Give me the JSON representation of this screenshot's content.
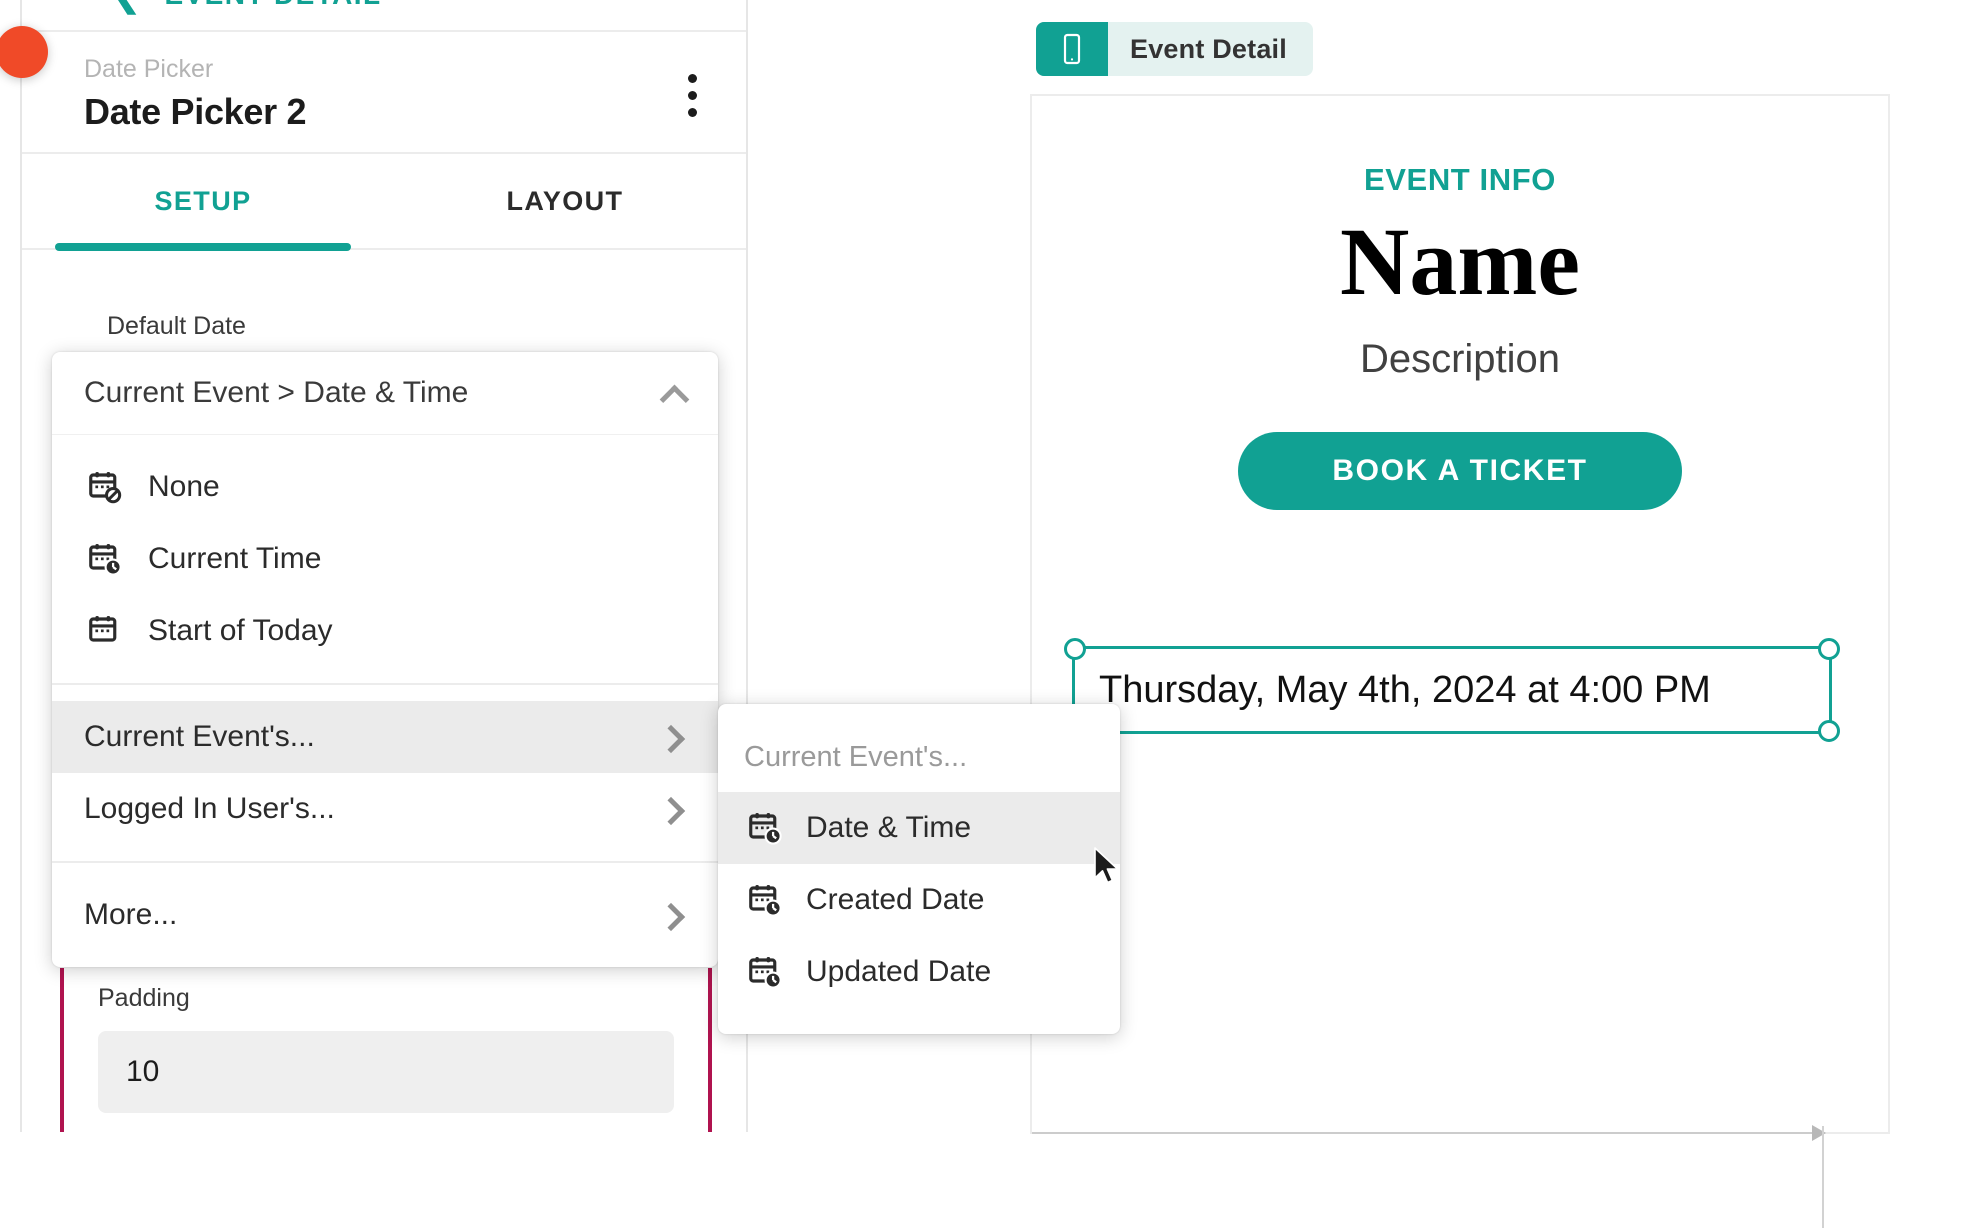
{
  "inspector": {
    "breadcrumb": {
      "label": "EVENT DETAIL",
      "chevron_icon": "chevron-left-icon"
    },
    "element": {
      "kind": "Date Picker",
      "name": "Date Picker 2",
      "menu_icon": "kebab-menu-icon"
    },
    "tabs": [
      {
        "label": "SETUP",
        "active": true
      },
      {
        "label": "LAYOUT",
        "active": false
      }
    ],
    "fields": {
      "default_date_label": "Default Date",
      "padding_label": "Padding",
      "padding_value": "10"
    }
  },
  "dropdown": {
    "header_value": "Current Event > Date & Time",
    "collapse_icon": "chevron-up-icon",
    "options": [
      {
        "label": "None",
        "icon": "calendar-none-icon"
      },
      {
        "label": "Current Time",
        "icon": "calendar-clock-icon"
      },
      {
        "label": "Start of Today",
        "icon": "calendar-icon"
      }
    ],
    "groups": [
      {
        "label": "Current Event's...",
        "icon": "chevron-right-icon",
        "highlighted": true
      },
      {
        "label": "Logged In User's...",
        "icon": "chevron-right-icon",
        "highlighted": false
      }
    ],
    "more": {
      "label": "More...",
      "icon": "chevron-right-icon"
    }
  },
  "submenu": {
    "title": "Current Event's...",
    "items": [
      {
        "label": "Date & Time",
        "icon": "calendar-clock-icon",
        "highlighted": true
      },
      {
        "label": "Created Date",
        "icon": "calendar-clock-icon",
        "highlighted": false
      },
      {
        "label": "Updated Date",
        "icon": "calendar-clock-icon",
        "highlighted": false
      }
    ]
  },
  "canvas": {
    "device_chip": {
      "label": "Event Detail",
      "icon": "phone-icon"
    },
    "preview": {
      "eyebrow": "EVENT INFO",
      "title": "Name",
      "description": "Description",
      "cta_label": "BOOK A TICKET",
      "selected_element_text": "Thursday, May 4th, 2024 at 4:00 PM"
    }
  },
  "colors": {
    "accent": "#11a193",
    "accent_soft": "#e4f2f0",
    "highlight_row": "#ebebeb",
    "notification": "#f04a28",
    "guide_border": "#b0134f"
  }
}
